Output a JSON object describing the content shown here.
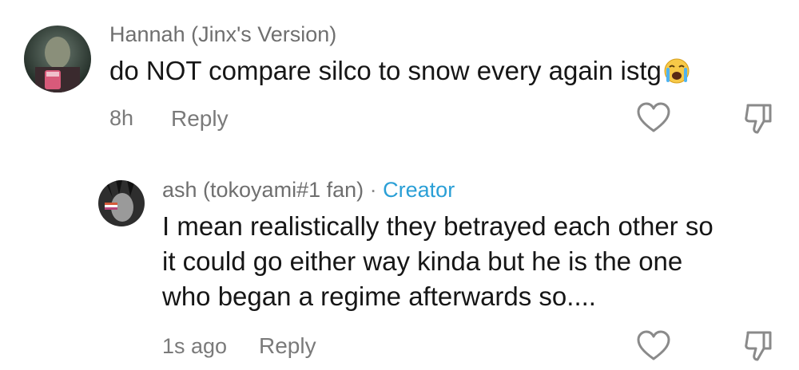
{
  "comments": [
    {
      "username": "Hannah (Jinx's Version)",
      "text": "do NOT compare silco to snow every again istg",
      "emoji": "loudly-crying-face",
      "time": "8h",
      "reply_label": "Reply"
    },
    {
      "username": "ash (tokoyami#1 fan)",
      "separator": "·",
      "badge": "Creator",
      "text_lines": [
        "I mean realistically they betrayed each other so",
        "it could go either way kinda but he is the one",
        "who began a regime afterwards so...."
      ],
      "time": "1s ago",
      "reply_label": "Reply"
    }
  ],
  "icons": {
    "like": "heart-outline-icon",
    "dislike": "thumbs-down-outline-icon"
  },
  "colors": {
    "creator_badge": "#2a9fd6",
    "meta_text": "#7a7a7a",
    "body_text": "#161616"
  }
}
